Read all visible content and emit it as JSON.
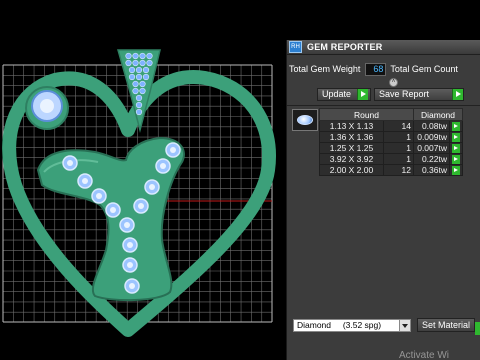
{
  "panel": {
    "title": "GEM REPORTER",
    "app_icon_text": "RH",
    "total_gem_weight_label": "Total Gem Weight",
    "total_gem_weight_value": "68",
    "total_gem_count_label": "Total Gem Count",
    "update_label": "Update",
    "save_report_label": "Save Report",
    "table": {
      "header_shape": "Round",
      "header_material": "Diamond",
      "rows": [
        {
          "size": "1.13 X 1.13",
          "count": "14",
          "weight": "0.08tw"
        },
        {
          "size": "1.36 X 1.36",
          "count": "1",
          "weight": "0.009tw"
        },
        {
          "size": "1.25 X 1.25",
          "count": "1",
          "weight": "0.007tw"
        },
        {
          "size": "3.92 X 3.92",
          "count": "1",
          "weight": "0.22tw"
        },
        {
          "size": "2.00 X 2.00",
          "count": "12",
          "weight": "0.36tw"
        }
      ]
    },
    "material_select": "Diamond     (3.52 spg)",
    "set_material_label": "Set Material",
    "watermark": "Activate Wi"
  },
  "colors": {
    "jewel_green": "#3ca07a",
    "grid": "#7a7a7a",
    "accent_play": "#2fb82f",
    "value_text": "#4bb8ff"
  }
}
